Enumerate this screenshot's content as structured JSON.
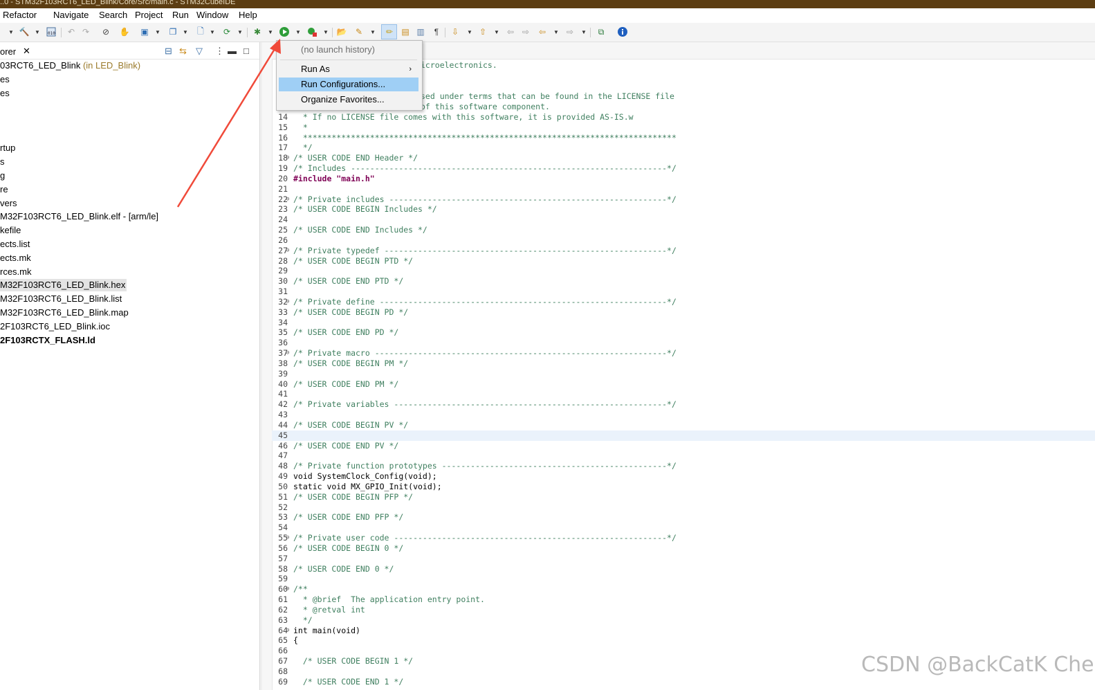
{
  "window": {
    "title": "..0 - STM32F103RCT6_LED_Blink/Core/Src/main.c - STM32CubeIDE"
  },
  "menubar": {
    "items": [
      "Refactor",
      "Navigate",
      "Search",
      "Project",
      "Run",
      "Window",
      "Help"
    ]
  },
  "toolbar": {
    "icons": [
      "hammer-icon",
      "binary-icon",
      "undo-nav-icon",
      "redo-nav-icon",
      "debug-icon",
      "run-icon",
      "external-tools-icon",
      "open-type-icon",
      "search-icon",
      "info-icon"
    ],
    "pressed_tool": "toggle-mark-occurrences"
  },
  "explorer": {
    "tab_label": "orer",
    "items": [
      {
        "label": "03RCT6_LED_Blink",
        "decoration": "(in LED_Blink)"
      },
      {
        "label": "es"
      },
      {
        "label": "es"
      },
      {
        "label": "rtup"
      },
      {
        "label": "s"
      },
      {
        "label": "g"
      },
      {
        "label": "re"
      },
      {
        "label": "vers"
      },
      {
        "label": "M32F103RCT6_LED_Blink.elf - [arm/le]"
      },
      {
        "label": "kefile"
      },
      {
        "label": "ects.list"
      },
      {
        "label": "ects.mk"
      },
      {
        "label": "rces.mk"
      },
      {
        "label": "M32F103RCT6_LED_Blink.hex",
        "selected": true
      },
      {
        "label": "M32F103RCT6_LED_Blink.list"
      },
      {
        "label": "M32F103RCT6_LED_Blink.map"
      },
      {
        "label": "2F103RCT6_LED_Blink.ioc"
      },
      {
        "label": "2F103RCTX_FLASH.ld",
        "bold": true
      }
    ]
  },
  "run_menu": {
    "history": "(no launch history)",
    "run_as": "Run As",
    "run_configurations": "Run Configurations...",
    "organize_favorites": "Organize Favorites..."
  },
  "editor": {
    "partial_lines": [
      "icroelectronics.",
      "sed under terms that can be found in the LICENSE file",
      "of this software component."
    ],
    "lines": [
      {
        "n": "14",
        "t": "  * If no LICENSE file comes with this software, it is provided AS-IS.w"
      },
      {
        "n": "15",
        "t": "  *"
      },
      {
        "n": "16",
        "t": "  ******************************************************************************"
      },
      {
        "n": "17",
        "t": "  */"
      },
      {
        "n": "18",
        "t": "/* USER CODE END Header */"
      },
      {
        "n": "19",
        "t": "/* Includes ------------------------------------------------------------------*/"
      },
      {
        "n": "20",
        "t": "#include \"main.h\""
      },
      {
        "n": "21",
        "t": ""
      },
      {
        "n": "22",
        "t": "/* Private includes ----------------------------------------------------------*/"
      },
      {
        "n": "23",
        "t": "/* USER CODE BEGIN Includes */"
      },
      {
        "n": "24",
        "t": ""
      },
      {
        "n": "25",
        "t": "/* USER CODE END Includes */"
      },
      {
        "n": "26",
        "t": ""
      },
      {
        "n": "27",
        "t": "/* Private typedef -----------------------------------------------------------*/"
      },
      {
        "n": "28",
        "t": "/* USER CODE BEGIN PTD */"
      },
      {
        "n": "29",
        "t": ""
      },
      {
        "n": "30",
        "t": "/* USER CODE END PTD */"
      },
      {
        "n": "31",
        "t": ""
      },
      {
        "n": "32",
        "t": "/* Private define ------------------------------------------------------------*/"
      },
      {
        "n": "33",
        "t": "/* USER CODE BEGIN PD */"
      },
      {
        "n": "34",
        "t": ""
      },
      {
        "n": "35",
        "t": "/* USER CODE END PD */"
      },
      {
        "n": "36",
        "t": ""
      },
      {
        "n": "37",
        "t": "/* Private macro -------------------------------------------------------------*/"
      },
      {
        "n": "38",
        "t": "/* USER CODE BEGIN PM */"
      },
      {
        "n": "39",
        "t": ""
      },
      {
        "n": "40",
        "t": "/* USER CODE END PM */"
      },
      {
        "n": "41",
        "t": ""
      },
      {
        "n": "42",
        "t": "/* Private variables ---------------------------------------------------------*/"
      },
      {
        "n": "43",
        "t": ""
      },
      {
        "n": "44",
        "t": "/* USER CODE BEGIN PV */"
      },
      {
        "n": "45",
        "t": ""
      },
      {
        "n": "46",
        "t": "/* USER CODE END PV */"
      },
      {
        "n": "47",
        "t": ""
      },
      {
        "n": "48",
        "t": "/* Private function prototypes -----------------------------------------------*/"
      },
      {
        "n": "49",
        "t": "void SystemClock_Config(void);"
      },
      {
        "n": "50",
        "t": "static void MX_GPIO_Init(void);"
      },
      {
        "n": "51",
        "t": "/* USER CODE BEGIN PFP */"
      },
      {
        "n": "52",
        "t": ""
      },
      {
        "n": "53",
        "t": "/* USER CODE END PFP */"
      },
      {
        "n": "54",
        "t": ""
      },
      {
        "n": "55",
        "t": "/* Private user code ---------------------------------------------------------*/"
      },
      {
        "n": "56",
        "t": "/* USER CODE BEGIN 0 */"
      },
      {
        "n": "57",
        "t": ""
      },
      {
        "n": "58",
        "t": "/* USER CODE END 0 */"
      },
      {
        "n": "59",
        "t": ""
      },
      {
        "n": "60",
        "t": "/**"
      },
      {
        "n": "61",
        "t": "  * @brief  The application entry point."
      },
      {
        "n": "62",
        "t": "  * @retval int"
      },
      {
        "n": "63",
        "t": "  */"
      },
      {
        "n": "64",
        "t": "int main(void)"
      },
      {
        "n": "65",
        "t": "{"
      },
      {
        "n": "66",
        "t": ""
      },
      {
        "n": "67",
        "t": "  /* USER CODE BEGIN 1 */"
      },
      {
        "n": "68",
        "t": ""
      },
      {
        "n": "69",
        "t": "  /* USER CODE END 1 */"
      }
    ]
  },
  "watermark": "CSDN @BackCatK Chen",
  "colors": {
    "title_bar": "#5c3d12",
    "menu_highlight": "#9fcff5",
    "annotation_arrow": "#f04a3a",
    "comment": "#3f7f5f",
    "keyword": "#7f0055",
    "string": "#2a00ff"
  }
}
